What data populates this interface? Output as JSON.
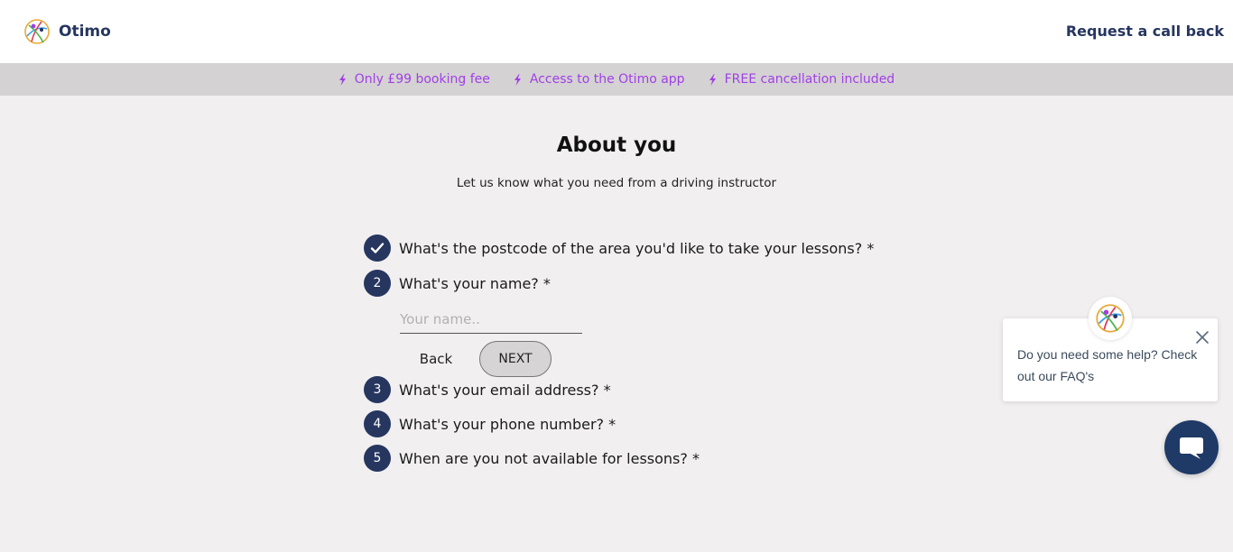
{
  "header": {
    "brand": "Otimo",
    "logo_icon": "otimo-logo-icon",
    "callback_label": "Request a call back"
  },
  "perks": [
    {
      "icon": "bolt-icon",
      "label": "Only £99 booking fee"
    },
    {
      "icon": "bolt-icon",
      "label": "Access to the Otimo app"
    },
    {
      "icon": "bolt-icon",
      "label": "FREE cancellation included"
    }
  ],
  "page": {
    "title": "About you",
    "subtitle": "Let us know what you need from a driving instructor"
  },
  "steps": [
    {
      "number": "",
      "icon": "check-icon",
      "status": "completed",
      "label": "What's the postcode of the area you'd like to take your lessons? *"
    },
    {
      "number": "2",
      "status": "active",
      "label": "What's your name? *"
    },
    {
      "number": "3",
      "status": "pending",
      "label": "What's your email address? *"
    },
    {
      "number": "4",
      "status": "pending",
      "label": "What's your phone number? *"
    },
    {
      "number": "5",
      "status": "pending",
      "label": "When are you not available for lessons? *"
    }
  ],
  "name_field": {
    "value": "",
    "placeholder": "Your name.."
  },
  "buttons": {
    "back_label": "Back",
    "next_label": "NEXT"
  },
  "help": {
    "text": "Do you need some help? Check out our FAQ's",
    "close_icon": "close-icon",
    "avatar_icon": "otimo-logo-icon",
    "chat_icon": "chat-bubble-icon"
  },
  "colors": {
    "brand_navy": "#26365f",
    "perk_purple": "#a23fe6",
    "page_bg": "#f1eff0",
    "perk_bar_bg": "#d4d2d3"
  }
}
